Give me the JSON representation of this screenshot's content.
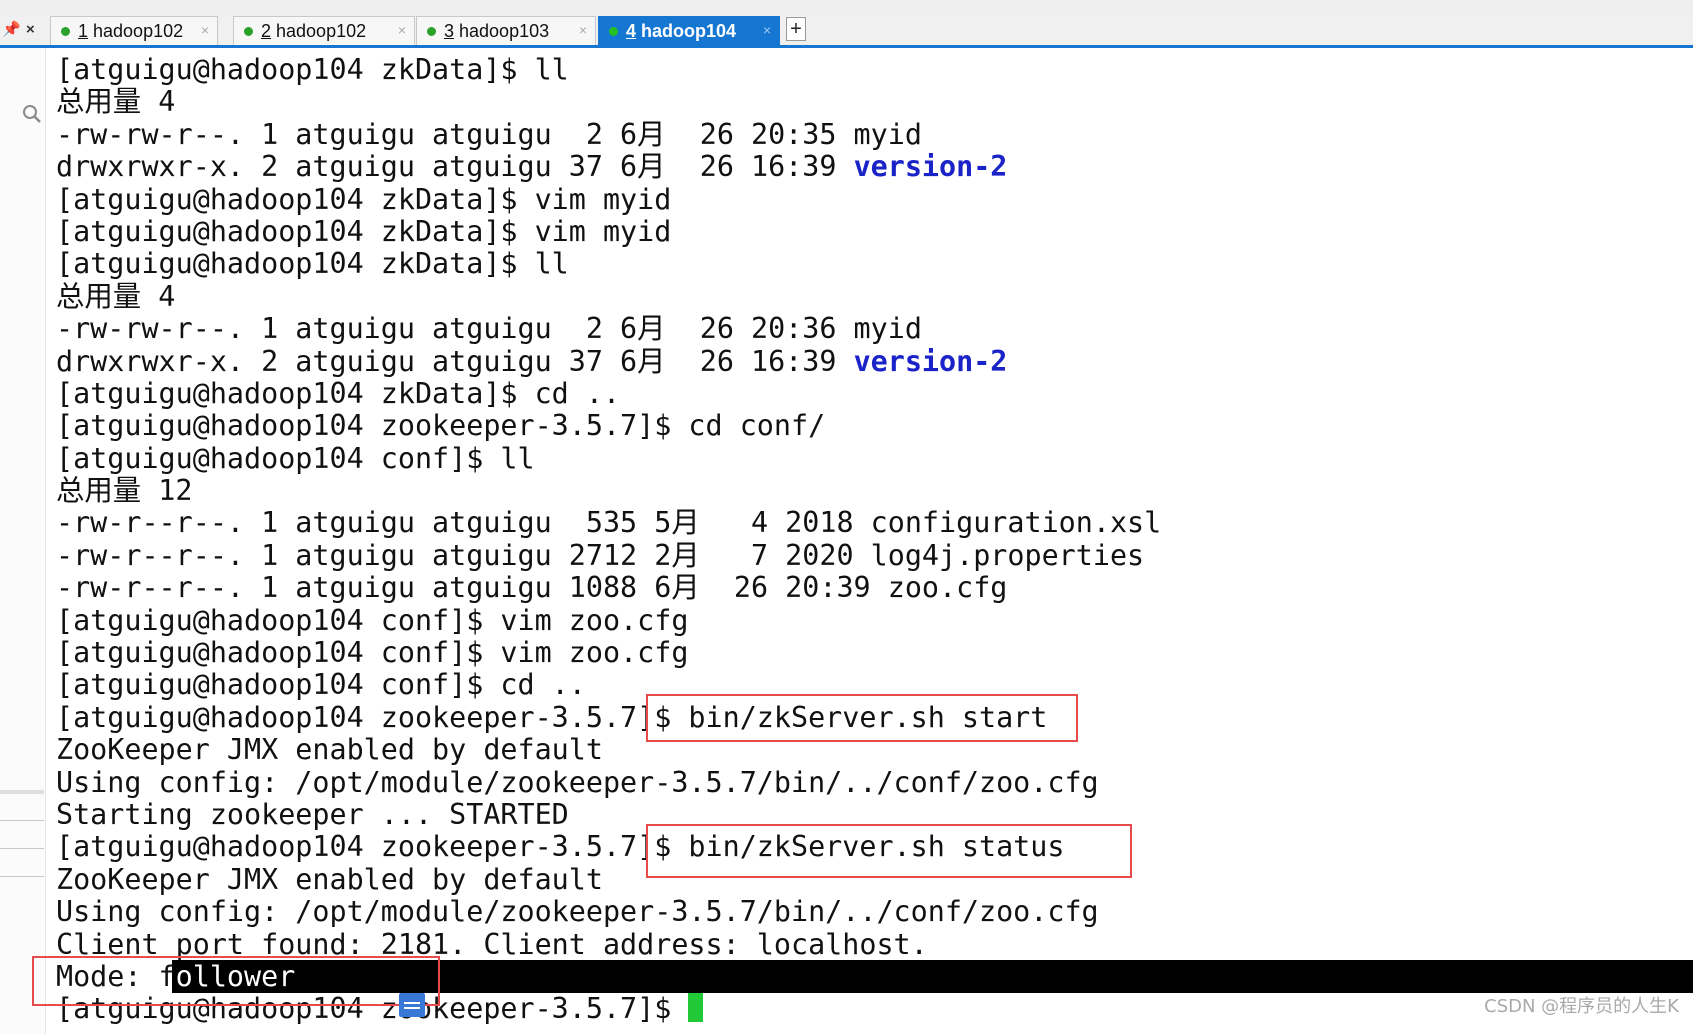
{
  "tabbar": {
    "pin_glyph": "📌",
    "close_all_glyph": "×",
    "tabs": [
      {
        "num": "1",
        "label": "hadoop102"
      },
      {
        "num": "2",
        "label": "hadoop102"
      },
      {
        "num": "3",
        "label": "hadoop103"
      },
      {
        "num": "4",
        "label": "hadoop104",
        "active": true
      }
    ],
    "tab_close_glyph": "×",
    "new_tab_glyph": "+"
  },
  "terminal": {
    "lines": [
      {
        "text": "[atguigu@hadoop104 zkData]$ ll"
      },
      {
        "text": "总用量 4"
      },
      {
        "text": "-rw-rw-r--. 1 atguigu atguigu  2 6月  26 20:35 myid"
      },
      {
        "text": "drwxrwxr-x. 2 atguigu atguigu 37 6月  26 16:39 ",
        "dir": "version-2"
      },
      {
        "text": "[atguigu@hadoop104 zkData]$ vim myid"
      },
      {
        "text": "[atguigu@hadoop104 zkData]$ vim myid"
      },
      {
        "text": "[atguigu@hadoop104 zkData]$ ll"
      },
      {
        "text": "总用量 4"
      },
      {
        "text": "-rw-rw-r--. 1 atguigu atguigu  2 6月  26 20:36 myid"
      },
      {
        "text": "drwxrwxr-x. 2 atguigu atguigu 37 6月  26 16:39 ",
        "dir": "version-2"
      },
      {
        "text": "[atguigu@hadoop104 zkData]$ cd .."
      },
      {
        "text": "[atguigu@hadoop104 zookeeper-3.5.7]$ cd conf/"
      },
      {
        "text": "[atguigu@hadoop104 conf]$ ll"
      },
      {
        "text": "总用量 12"
      },
      {
        "text": "-rw-r--r--. 1 atguigu atguigu  535 5月   4 2018 configuration.xsl"
      },
      {
        "text": "-rw-r--r--. 1 atguigu atguigu 2712 2月   7 2020 log4j.properties"
      },
      {
        "text": "-rw-r--r--. 1 atguigu atguigu 1088 6月  26 20:39 zoo.cfg"
      },
      {
        "text": "[atguigu@hadoop104 conf]$ vim zoo.cfg"
      },
      {
        "text": "[atguigu@hadoop104 conf]$ vim zoo.cfg"
      },
      {
        "text": "[atguigu@hadoop104 conf]$ cd .."
      },
      {
        "text": "[atguigu@hadoop104 zookeeper-3.5.7]$ bin/zkServer.sh start"
      },
      {
        "text": "ZooKeeper JMX enabled by default"
      },
      {
        "text": "Using config: /opt/module/zookeeper-3.5.7/bin/../conf/zoo.cfg"
      },
      {
        "text": "Starting zookeeper ... STARTED"
      },
      {
        "text": "[atguigu@hadoop104 zookeeper-3.5.7]$ bin/zkServer.sh status"
      },
      {
        "text": "ZooKeeper JMX enabled by default"
      },
      {
        "text": "Using config: /opt/module/zookeeper-3.5.7/bin/../conf/zoo.cfg"
      },
      {
        "text": "Client port found: 2181. Client address: localhost."
      },
      {
        "text": "Mode: f",
        "inv": "ollower"
      },
      {
        "text": "[atguigu@hadoop104 zookeeper-3.5.7]$ ",
        "cursor": true
      }
    ]
  },
  "watermark": "CSDN @程序员的人生K",
  "colors": {
    "tab_active": "#1677d2",
    "dir_text": "#1a23c8",
    "highlight_box": "#e84b4b",
    "cursor": "#22c936",
    "status_dot": "#2aa12a"
  }
}
